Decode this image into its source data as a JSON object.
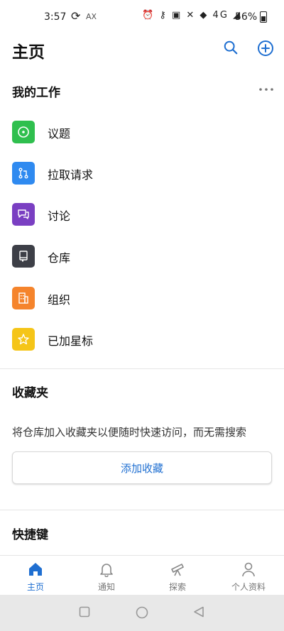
{
  "status_bar": {
    "time": "3:57",
    "sync_glyph": "⟳",
    "carrier_tag": "AX",
    "indicator_glyphs": "⏰ ⚷ ▣ ✕ ◆ 4G ◢",
    "battery": "56%"
  },
  "header": {
    "title": "主页",
    "search_icon": "search-icon",
    "add_icon": "add-circle-icon"
  },
  "my_work": {
    "title": "我的工作",
    "more_icon": "more-horizontal-icon",
    "items": [
      {
        "label": "议题",
        "icon": "issue-icon",
        "color": "#2fbf4e"
      },
      {
        "label": "拉取请求",
        "icon": "pull-request-icon",
        "color": "#2f8af0"
      },
      {
        "label": "讨论",
        "icon": "discussion-icon",
        "color": "#7a3fc2"
      },
      {
        "label": "仓库",
        "icon": "repository-icon",
        "color": "#3d3f47"
      },
      {
        "label": "组织",
        "icon": "organization-icon",
        "color": "#f5842c"
      },
      {
        "label": "已加星标",
        "icon": "star-icon",
        "color": "#f5c518"
      }
    ]
  },
  "favorites": {
    "title": "收藏夹",
    "description": "将仓库加入收藏夹以便随时快速访问，而无需搜索",
    "button_label": "添加收藏"
  },
  "shortcuts": {
    "title": "快捷键"
  },
  "bottom_nav": {
    "active_color": "#1f6fd1",
    "tabs": [
      {
        "label": "主页",
        "icon": "home-icon",
        "active": true
      },
      {
        "label": "通知",
        "icon": "bell-icon",
        "active": false
      },
      {
        "label": "探索",
        "icon": "telescope-icon",
        "active": false
      },
      {
        "label": "个人资料",
        "icon": "person-icon",
        "active": false
      }
    ]
  },
  "android_nav": {
    "buttons": [
      "recents-icon",
      "home-circle-icon",
      "back-icon"
    ]
  }
}
